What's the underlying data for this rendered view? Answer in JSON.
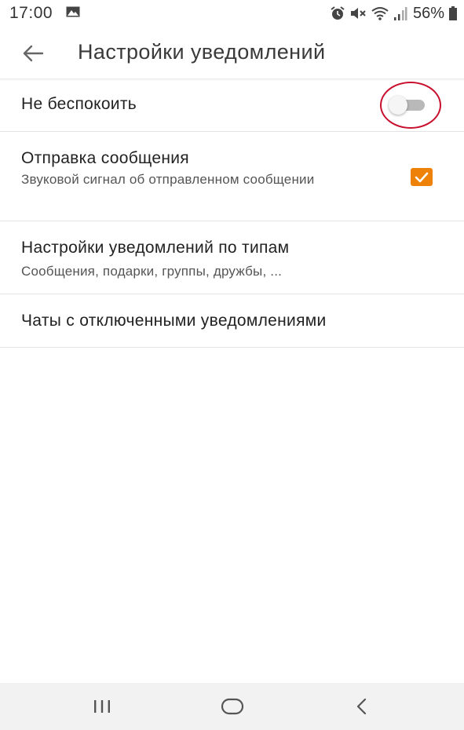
{
  "status_bar": {
    "time": "17:00",
    "battery": "56%",
    "icons": [
      "gallery-icon",
      "alarm-icon",
      "mute-icon",
      "wifi-icon",
      "signal-icon",
      "battery-icon"
    ]
  },
  "header": {
    "back_icon": "arrow-left-icon",
    "title": "Настройки уведомлений"
  },
  "settings": {
    "do_not_disturb": {
      "title": "Не беспокоить",
      "enabled": false
    },
    "send_message": {
      "title": "Отправка сообщения",
      "subtitle": "Звуковой сигнал об отправленном сообщении",
      "checked": true
    },
    "type_settings": {
      "title": "Настройки уведомлений по типам",
      "subtitle": "Сообщения, подарки, группы, дружбы, ..."
    },
    "muted_chats": {
      "title": "Чаты с отключенными уведомлениями"
    }
  },
  "colors": {
    "accent": "#ee8208",
    "toggle_track_off": "#b9b9b9",
    "annotation_circle": "#c8102e",
    "nav_bar_bg": "#f2f2f2"
  },
  "nav_bar": {
    "icons": [
      "recents-icon",
      "home-icon",
      "back-icon"
    ]
  }
}
